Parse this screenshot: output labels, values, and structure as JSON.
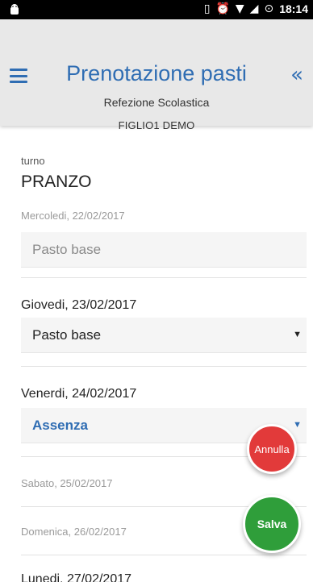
{
  "status_bar": {
    "time": "18:14",
    "icons": [
      "android-icon",
      "vibrate-icon",
      "alarm-icon",
      "wifi-icon",
      "signal-icon",
      "sync-icon"
    ]
  },
  "header": {
    "title": "Prenotazione pasti",
    "subtitle": "Refezione Scolastica",
    "child": "FIGLIO1 DEMO"
  },
  "turno": {
    "label": "turno",
    "value": "PRANZO"
  },
  "days": [
    {
      "date": "Mercoledi, 22/02/2017",
      "meal": "Pasto base"
    },
    {
      "date": "Giovedi, 23/02/2017",
      "meal": "Pasto base"
    },
    {
      "date": "Venerdi, 24/02/2017",
      "meal": "Assenza"
    },
    {
      "date": "Sabato, 25/02/2017"
    },
    {
      "date": "Domenica, 26/02/2017"
    },
    {
      "date": "Lunedi, 27/02/2017"
    }
  ],
  "actions": {
    "cancel_label": "Annulla",
    "save_label": "Salva"
  },
  "colors": {
    "accent": "#2f6db3",
    "cancel": "#e23a3a",
    "save": "#2f9e3a"
  }
}
